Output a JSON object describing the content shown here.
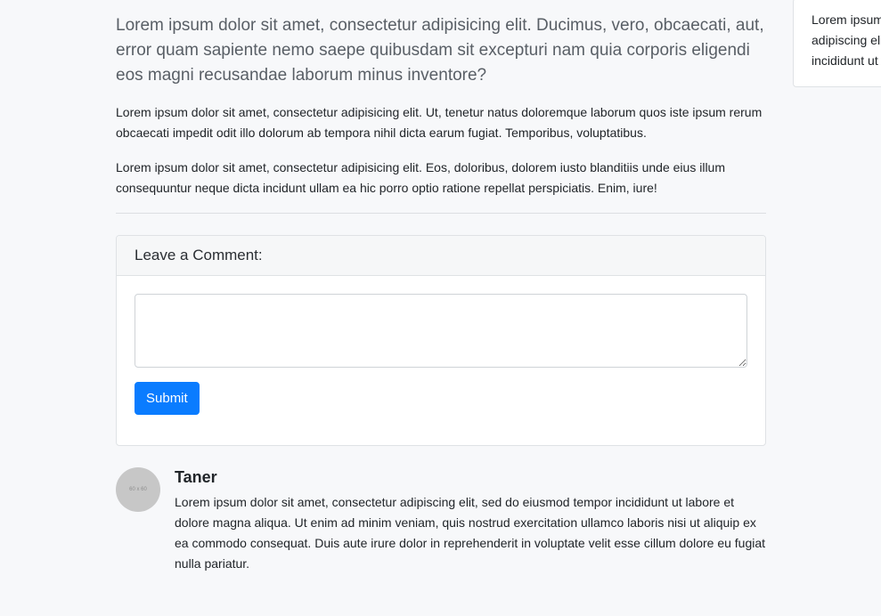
{
  "post": {
    "lead": "Lorem ipsum dolor sit amet, consectetur adipisicing elit. Ducimus, vero, obcaecati, aut, error quam sapiente nemo saepe quibusdam sit excepturi nam quia corporis eligendi eos magni recusandae laborum minus inventore?",
    "paragraphs": [
      "Lorem ipsum dolor sit amet, consectetur adipisicing elit. Ut, tenetur natus doloremque laborum quos iste ipsum rerum obcaecati impedit odit illo dolorum ab tempora nihil dicta earum fugiat. Temporibus, voluptatibus.",
      "Lorem ipsum dolor sit amet, consectetur adipisicing elit. Eos, doloribus, dolorem iusto blanditiis unde eius illum consequuntur neque dicta incidunt ullam ea hic porro optio ratione repellat perspiciatis. Enim, iure!"
    ]
  },
  "comment_form": {
    "title": "Leave a Comment:",
    "textarea_value": "",
    "submit_label": "Submit"
  },
  "comments": [
    {
      "avatar_text": "60 x 60",
      "author": "Taner",
      "text": "Lorem ipsum dolor sit amet, consectetur adipiscing elit, sed do eiusmod tempor incididunt ut labore et dolore magna aliqua. Ut enim ad minim veniam, quis nostrud exercitation ullamco laboris nisi ut aliquip ex ea commodo consequat. Duis aute irure dolor in reprehenderit in voluptate velit esse cillum dolore eu fugiat nulla pariatur."
    }
  ],
  "sidebar": {
    "widget_text": "Lorem ipsum dolor sit amet, consectetur adipiscing elit, sed do eiusmod tempor incididunt ut labore"
  },
  "colors": {
    "primary": "#0a7cff",
    "background": "#f7f8fa"
  }
}
